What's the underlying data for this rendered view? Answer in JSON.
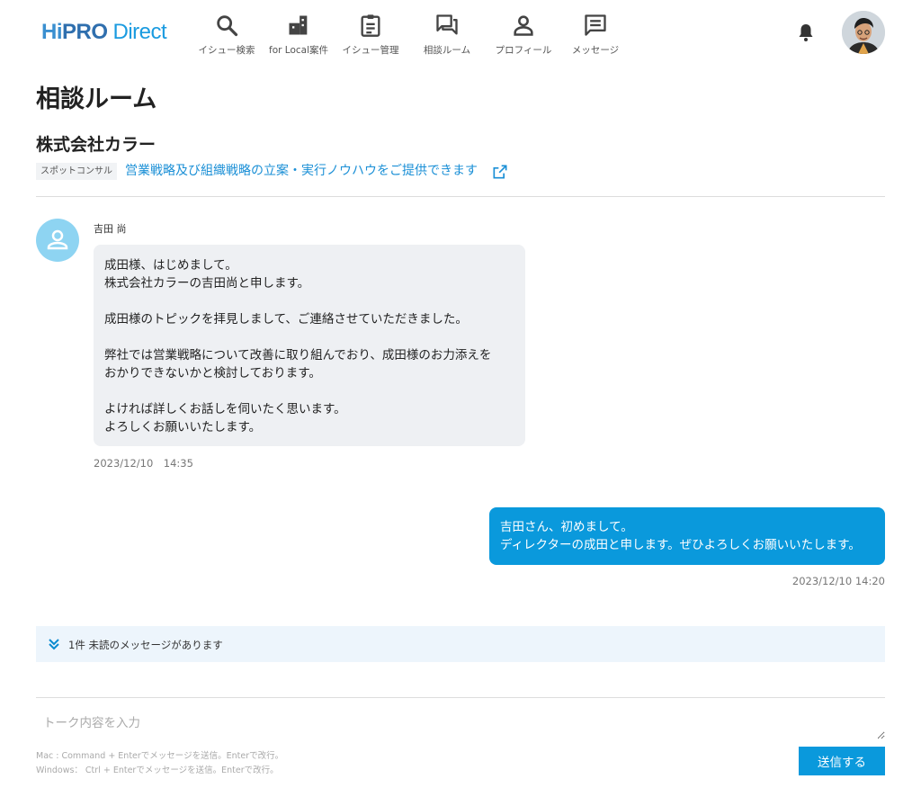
{
  "brand": {
    "hi": "Hi",
    "pro": "PRO",
    "direct": "Direct"
  },
  "nav": [
    {
      "icon": "search-icon",
      "label": "イシュー検索"
    },
    {
      "icon": "building-icon",
      "label": "for Local案件"
    },
    {
      "icon": "clipboard-icon",
      "label": "イシュー管理"
    },
    {
      "icon": "chat-bubbles-icon",
      "label": "相談ルーム"
    },
    {
      "icon": "person-icon",
      "label": "プロフィール"
    },
    {
      "icon": "message-icon",
      "label": "メッセージ"
    }
  ],
  "page_title": "相談ルーム",
  "company_name": "株式会社カラー",
  "tag": "スポットコンサル",
  "topic": "営業戦略及び組織戦略の立案・実行ノウハウをご提供できます",
  "messages": {
    "incoming": {
      "sender": "吉田 尚",
      "body": "成田様、はじめまして。\n株式会社カラーの吉田尚と申します。\n\n成田様のトピックを拝見しまして、ご連絡させていただきました。\n\n弊社では営業戦略について改善に取り組んでおり、成田様のお力添えを\nおかりできないかと検討しております。\n\nよければ詳しくお話しを伺いたく思います。\nよろしくお願いいたします。",
      "time": "2023/12/10　14:35"
    },
    "outgoing": {
      "body": "吉田さん、初めまして。\nディレクターの成田と申します。ぜひよろしくお願いいたします。",
      "time": "2023/12/10 14:20"
    }
  },
  "unread": "1件 未読のメッセージがあります",
  "composer": {
    "placeholder": "トーク内容を入力",
    "hint_mac": "Mac : Command + Enterでメッセージを送信。Enterで改行。",
    "hint_win": "Windows： Ctrl + Enterでメッセージを送信。Enterで改行。",
    "send_label": "送信する"
  },
  "colors": {
    "accent": "#0a99dc",
    "incoming_bubble": "#eef0f3",
    "unread_bg": "#edf5fc",
    "avatar_bg": "#8ed4f2"
  }
}
